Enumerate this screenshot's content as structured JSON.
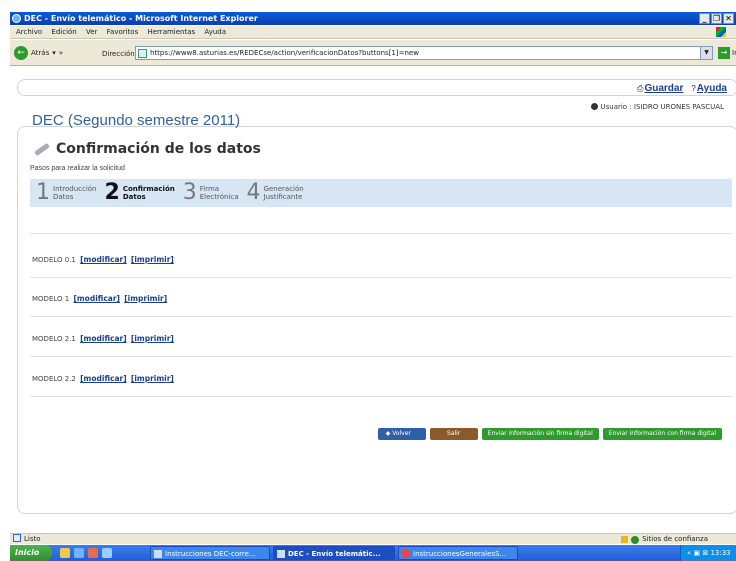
{
  "window": {
    "title": "DEC - Envío telemático - Microsoft Internet Explorer",
    "controls": [
      "_",
      "❐",
      "✕"
    ]
  },
  "menu": [
    "Archivo",
    "Edición",
    "Ver",
    "Favoritos",
    "Herramientas",
    "Ayuda"
  ],
  "toolbar": {
    "back_label": "Atrás",
    "address_label": "Dirección",
    "url": "https://www8.asturias.es/REDECse/action/verificacionDatos?buttons[1]=new",
    "go_label": "Ir"
  },
  "page": {
    "top_links": [
      {
        "prefix": "⎙",
        "label": "Guardar"
      },
      {
        "prefix": "?",
        "label": "Ayuda"
      }
    ],
    "user": "Usuario : ISIDRO URONES PASCUAL",
    "section_title": "DEC (Segundo semestre 2011)",
    "page_title": "Confirmación de los datos",
    "subtitle": "Pasos para realizar la solicitud",
    "steps": [
      {
        "num": "1",
        "line1": "Introducción",
        "line2": "Datos",
        "active": false
      },
      {
        "num": "2",
        "line1": "Confirmación",
        "line2": "Datos",
        "active": true
      },
      {
        "num": "3",
        "line1": "Firma",
        "line2": "Electrónica",
        "active": false
      },
      {
        "num": "4",
        "line1": "Generación",
        "line2": "Justificante",
        "active": false
      }
    ],
    "modelos": [
      {
        "name": "MODELO 0.1",
        "modify": "[modificar]",
        "print": "[imprimir]"
      },
      {
        "name": "MODELO 1",
        "modify": "[modificar]",
        "print": "[imprimir]"
      },
      {
        "name": "MODELO 2.1",
        "modify": "[modificar]",
        "print": "[imprimir]"
      },
      {
        "name": "MODELO 2.2",
        "modify": "[modificar]",
        "print": "[imprimir]"
      }
    ],
    "buttons": {
      "volver": "Volver",
      "salir": "Salir",
      "sin_firma": "Enviar información sin firma digital",
      "con_firma": "Enviar información con firma digital"
    }
  },
  "statusbar": {
    "status": "Listo",
    "zone": "Sitios de confianza"
  },
  "taskbar": {
    "start": "Inicio",
    "tasks": [
      {
        "label": "Instrucciones DEC-corre...",
        "active": false
      },
      {
        "label": "DEC - Envío telemátic...",
        "active": true
      },
      {
        "label": "InstruccionesGeneralesS...",
        "active": false
      }
    ],
    "clock": "13:33"
  },
  "colors": {
    "accent_blue": "#2f5fa5",
    "steps_bg": "#d6e6f5",
    "btn_volver": "#2e5fa8",
    "btn_salir": "#8b5a2b",
    "btn_green": "#2f9b2f"
  }
}
